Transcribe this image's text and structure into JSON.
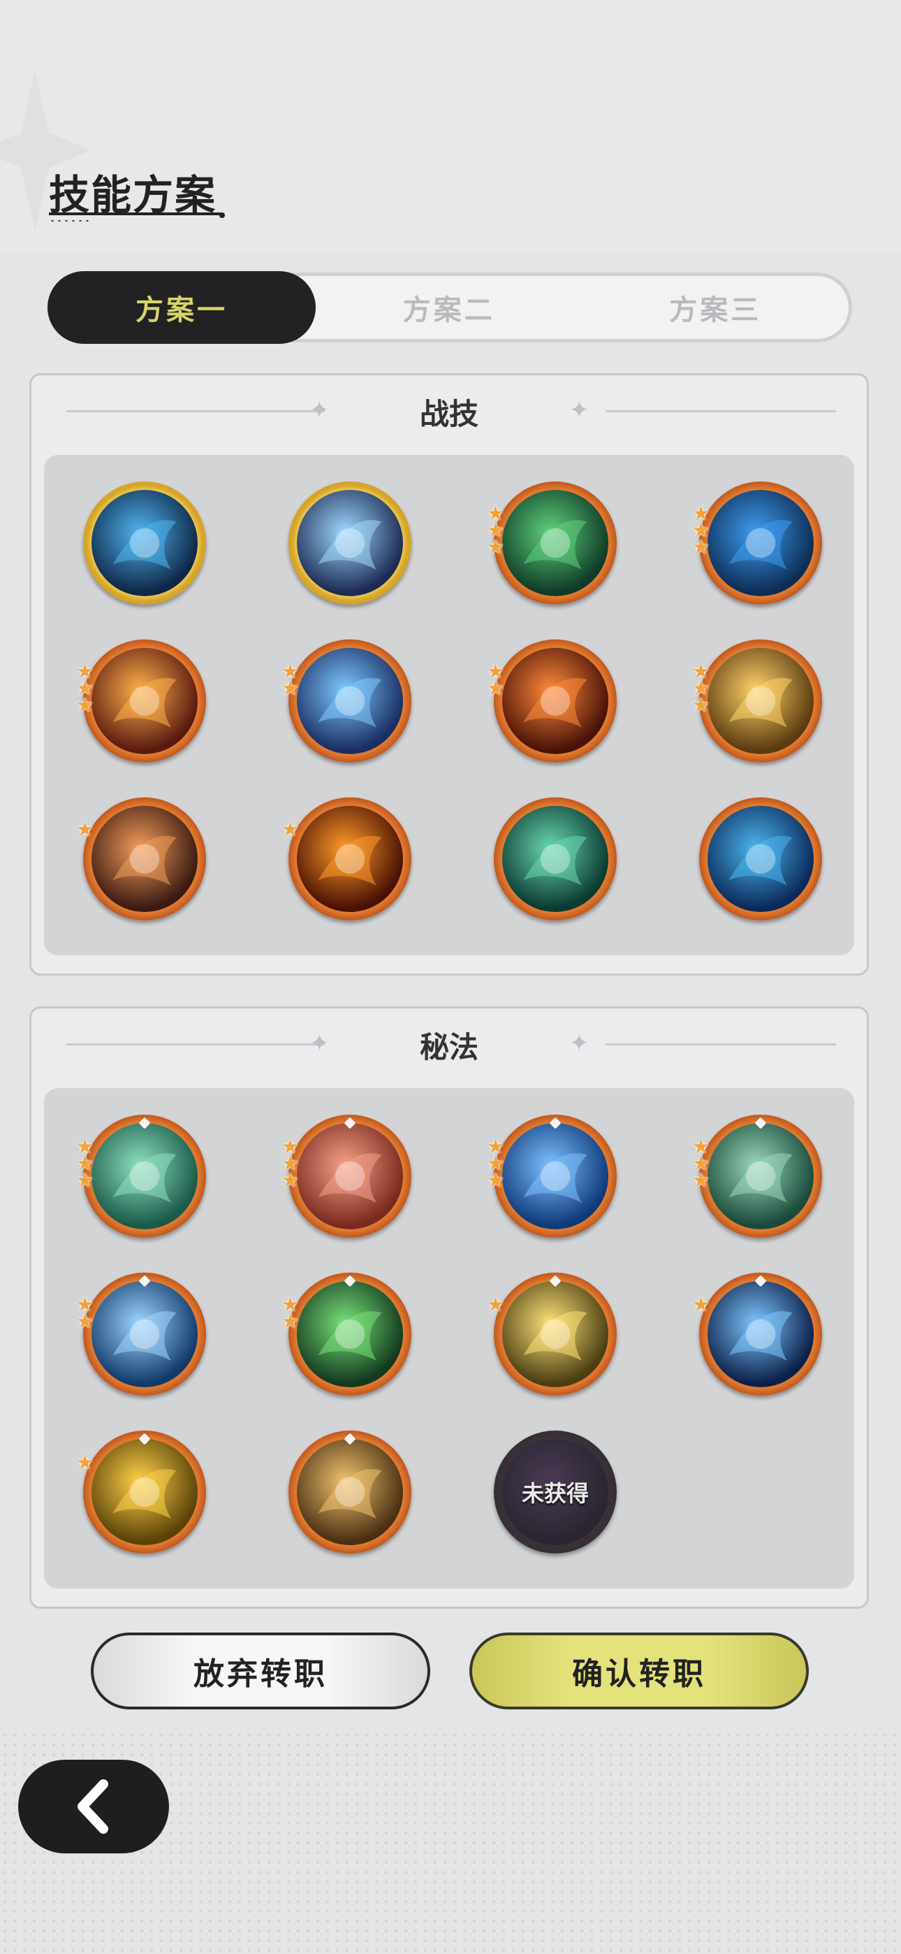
{
  "page": {
    "title": "技能方案"
  },
  "tabs": [
    {
      "label": "方案一",
      "active": true
    },
    {
      "label": "方案二",
      "active": false
    },
    {
      "label": "方案三",
      "active": false
    }
  ],
  "combat_skills": {
    "title": "战技",
    "icons": [
      {
        "name": "ice-shard-icon",
        "stars": 0,
        "ring": "gold",
        "colors": [
          "#0f2746",
          "#4fb4f0"
        ]
      },
      {
        "name": "ice-spikes-icon",
        "stars": 0,
        "ring": "gold",
        "colors": [
          "#1d2b52",
          "#9ed8ff"
        ]
      },
      {
        "name": "heal-cross-icon",
        "stars": 3,
        "ring": "orange",
        "colors": [
          "#0f3b27",
          "#5fd07c"
        ]
      },
      {
        "name": "blue-flame-icon",
        "stars": 3,
        "ring": "orange",
        "colors": [
          "#0d2d55",
          "#3e9cf0"
        ]
      },
      {
        "name": "fireball-icon",
        "stars": 3,
        "ring": "orange",
        "colors": [
          "#5a1a10",
          "#ffb14a"
        ]
      },
      {
        "name": "ice-burst-icon",
        "stars": 2,
        "ring": "orange",
        "colors": [
          "#1a2e63",
          "#7ec9ff"
        ]
      },
      {
        "name": "fire-wave-icon",
        "stars": 2,
        "ring": "orange",
        "colors": [
          "#4a1208",
          "#ff8a3a"
        ]
      },
      {
        "name": "light-beam-icon",
        "stars": 3,
        "ring": "orange",
        "colors": [
          "#5b3b10",
          "#ffd36a"
        ]
      },
      {
        "name": "meteor-icon",
        "stars": 1,
        "ring": "orange",
        "colors": [
          "#3a1a12",
          "#f39c5a"
        ]
      },
      {
        "name": "fire-explosion-icon",
        "stars": 1,
        "ring": "orange",
        "colors": [
          "#4a1004",
          "#ff9a2a"
        ]
      },
      {
        "name": "wind-orb-icon",
        "stars": 0,
        "ring": "orange",
        "colors": [
          "#0b3a32",
          "#6ad7b0"
        ]
      },
      {
        "name": "water-vortex-icon",
        "stars": 0,
        "ring": "orange",
        "colors": [
          "#0b2a5a",
          "#4bb5ee"
        ]
      }
    ]
  },
  "secret_arts": {
    "title": "秘法",
    "icons": [
      {
        "name": "nature-emblem-icon",
        "stars": 3,
        "ring": "orange",
        "colors": [
          "#1a5a4a",
          "#8fe0c0"
        ]
      },
      {
        "name": "fire-figure-icon",
        "stars": 3,
        "ring": "orange",
        "colors": [
          "#7a2a1e",
          "#f5a08a"
        ]
      },
      {
        "name": "water-figure-icon",
        "stars": 3,
        "ring": "orange",
        "colors": [
          "#0f3a7a",
          "#7ec0ff"
        ]
      },
      {
        "name": "shield-emblem-icon",
        "stars": 3,
        "ring": "orange",
        "colors": [
          "#1a4a3a",
          "#9ad8bb"
        ]
      },
      {
        "name": "ice-crystal-icon",
        "stars": 2,
        "ring": "orange",
        "colors": [
          "#123a6a",
          "#9ed6ff"
        ]
      },
      {
        "name": "leaf-slash-icon",
        "stars": 2,
        "ring": "orange",
        "colors": [
          "#123a1e",
          "#7ae07a"
        ]
      },
      {
        "name": "uplift-arrows-icon",
        "stars": 1,
        "ring": "orange",
        "colors": [
          "#4a3e12",
          "#ffe27a"
        ]
      },
      {
        "name": "diamond-core-icon",
        "stars": 1,
        "ring": "orange",
        "colors": [
          "#0c2048",
          "#7ec6ff"
        ]
      },
      {
        "name": "gold-figure-icon",
        "stars": 1,
        "ring": "orange",
        "colors": [
          "#5a4208",
          "#ffd24a"
        ]
      },
      {
        "name": "star-pierce-icon",
        "stars": 0,
        "ring": "orange",
        "colors": [
          "#4a3012",
          "#f0c270"
        ]
      },
      {
        "name": "locked-skill-icon",
        "stars": 0,
        "ring": "dark",
        "locked": true,
        "label": "未获得",
        "colors": [
          "#2a2530",
          "#4a3a55"
        ]
      }
    ]
  },
  "buttons": {
    "abandon": "放弃转职",
    "confirm": "确认转职"
  },
  "nav": {
    "back_icon": "chevron-left-icon"
  }
}
